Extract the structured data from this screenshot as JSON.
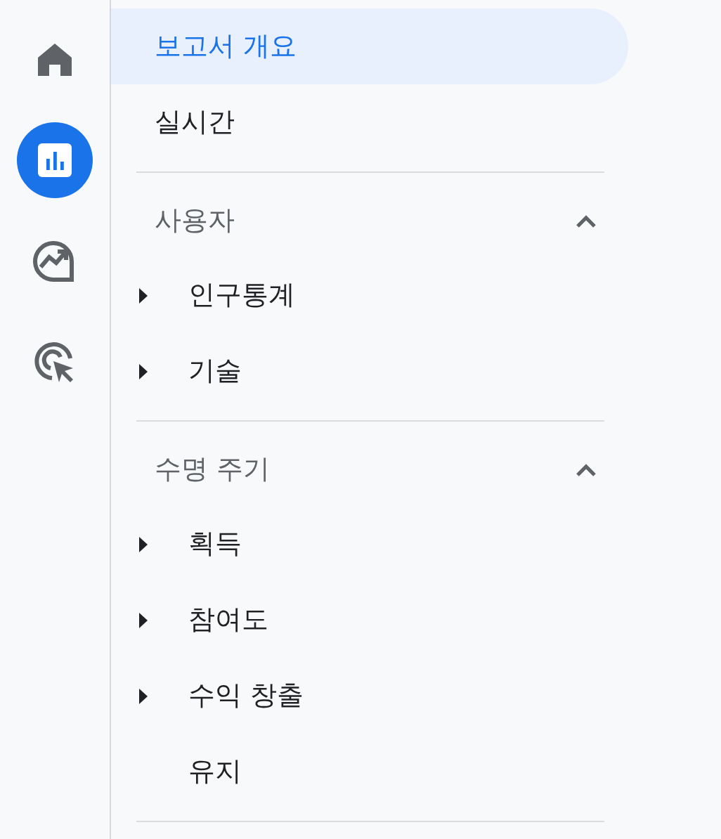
{
  "rail": [
    {
      "kind": "home",
      "selected": false
    },
    {
      "kind": "reports",
      "selected": true
    },
    {
      "kind": "explore",
      "selected": false
    },
    {
      "kind": "advertising",
      "selected": false
    }
  ],
  "nav": [
    {
      "label": "보고서 개요",
      "selected": true
    },
    {
      "label": "실시간",
      "selected": false
    }
  ],
  "sections": [
    {
      "title": "사용자",
      "expanded": true,
      "items": [
        {
          "label": "인구통계",
          "expandable": true
        },
        {
          "label": "기술",
          "expandable": true
        }
      ]
    },
    {
      "title": "수명 주기",
      "expanded": true,
      "items": [
        {
          "label": "획득",
          "expandable": true
        },
        {
          "label": "참여도",
          "expandable": true
        },
        {
          "label": "수익 창출",
          "expandable": true
        },
        {
          "label": "유지",
          "expandable": false
        }
      ]
    }
  ]
}
